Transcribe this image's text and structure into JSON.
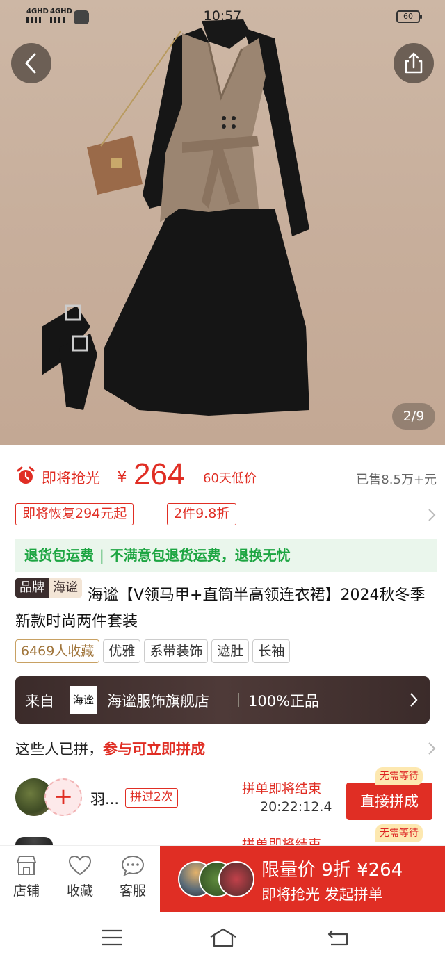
{
  "status_bar": {
    "time": "10:57",
    "signal_1": "4GHD",
    "signal_2": "4GHD",
    "battery": "60"
  },
  "gallery": {
    "counter": "2/9"
  },
  "price": {
    "flash_label": "即将抢光",
    "currency": "¥",
    "amount": "264",
    "low_tag": "60天低价",
    "sold": "已售8.5万+元"
  },
  "promos": [
    "即将恢复294元起",
    "2件9.8折"
  ],
  "return_policy": {
    "part1": "退货包运费",
    "separator": "|",
    "part2": "不满意包退货运费，退换无忧"
  },
  "product": {
    "brand_label": "品牌",
    "brand_name": "海谧",
    "title": "海谧【V领马甲+直筒半高领连衣裙】2024秋冬季新款时尚两件套装"
  },
  "tags": [
    "6469人收藏",
    "优雅",
    "系带装饰",
    "遮肚",
    "长袖"
  ],
  "store": {
    "from_label": "来自",
    "logo_text": "海谧",
    "name": "海谧服饰旗舰店",
    "genuine": "100%正品"
  },
  "group_buy": {
    "heading": "这些人已拼，",
    "heading_highlight": "参与可立即拼成",
    "rows": [
      {
        "name": "羽...",
        "badge": "拼过2次",
        "status": "拼单即将结束",
        "timer": "20:22:12.4",
        "button": "直接拼成",
        "no_wait": "无需等待"
      },
      {
        "status": "拼单即将结束",
        "no_wait": "无需等待"
      }
    ]
  },
  "bottom_bar": {
    "store": "店铺",
    "favorite": "收藏",
    "service": "客服",
    "buy_line1": "限量价 9折 ¥264",
    "buy_line2": "即将抢光 发起拼单"
  },
  "colors": {
    "accent_red": "#e02e24",
    "green": "#1da542",
    "store_bar": "#3b2b2a"
  }
}
